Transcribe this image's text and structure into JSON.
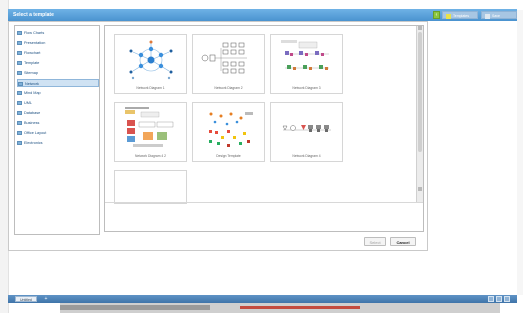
{
  "window": {
    "title": "Select a template"
  },
  "toolbar": {
    "templates_label": "Templates",
    "save_diagram_label": "Save Diagram"
  },
  "sidebar": {
    "items": [
      {
        "label": "Flow Charts"
      },
      {
        "label": "Presentation"
      },
      {
        "label": "Flowchart"
      },
      {
        "label": "Template"
      },
      {
        "label": "Sitemap"
      },
      {
        "label": "Network",
        "selected": true
      },
      {
        "label": "Mind Map"
      },
      {
        "label": "UML"
      },
      {
        "label": "Database"
      },
      {
        "label": "Business"
      },
      {
        "label": "Office Layout"
      },
      {
        "label": "Electronics"
      }
    ]
  },
  "templates": [
    {
      "caption": "Network Diagram 1"
    },
    {
      "caption": "Network Diagram 2"
    },
    {
      "caption": "Network Diagram 3"
    },
    {
      "caption": "Network Diagram 4 2"
    },
    {
      "caption": "Design Template"
    },
    {
      "caption": "Network Diagram 4"
    }
  ],
  "buttons": {
    "select": "Select",
    "cancel": "Cancel"
  },
  "taskbar": {
    "page_tab": "Untitled",
    "add": "+"
  },
  "colors": {
    "accent": "#4a93cf",
    "selected_bg": "#cfe2f3",
    "tab_bar": "#3f74a9"
  }
}
